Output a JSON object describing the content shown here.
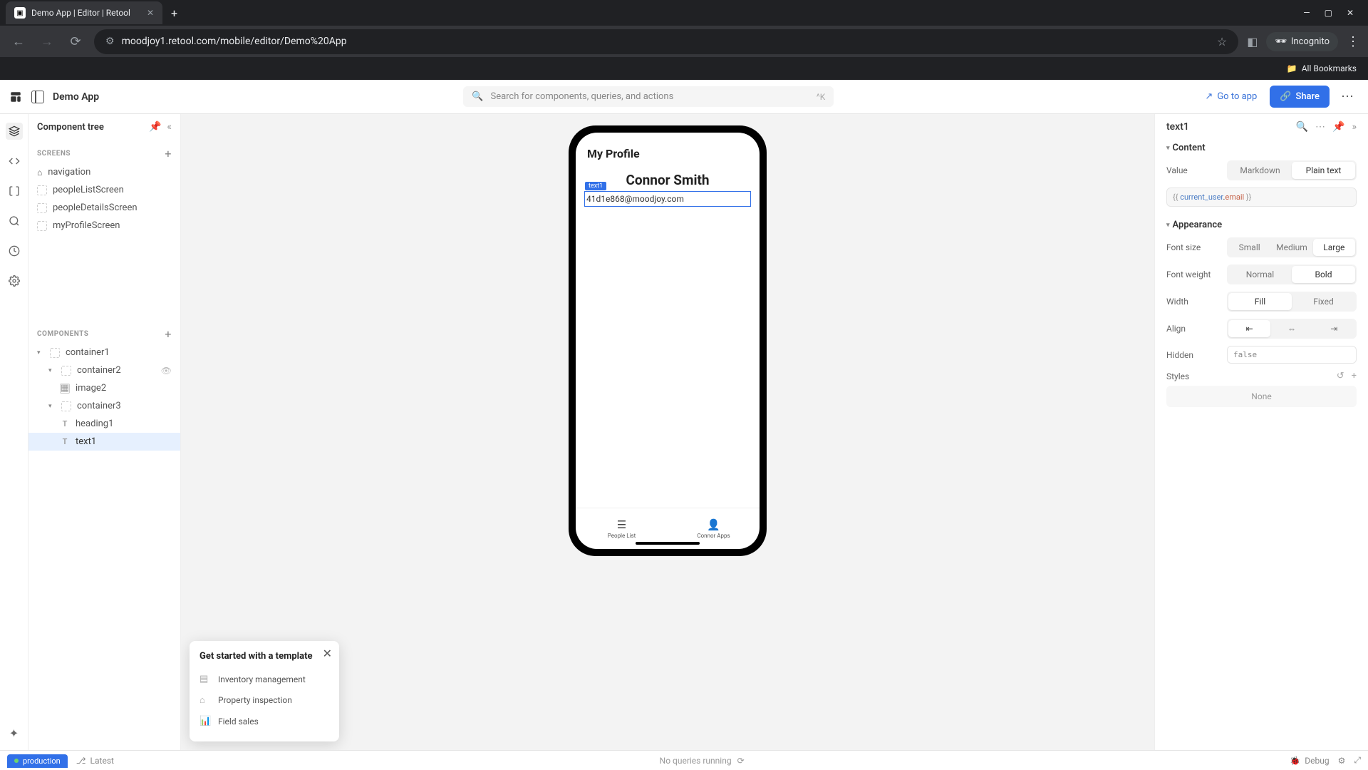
{
  "browser": {
    "tab_title": "Demo App | Editor | Retool",
    "url": "moodjoy1.retool.com/mobile/editor/Demo%20App",
    "incognito_label": "Incognito",
    "all_bookmarks": "All Bookmarks"
  },
  "topbar": {
    "app_name": "Demo App",
    "search_placeholder": "Search for components, queries, and actions",
    "search_shortcut": "^K",
    "go_to_app": "Go to app",
    "share": "Share"
  },
  "left_panel": {
    "title": "Component tree",
    "screens_label": "SCREENS",
    "components_label": "COMPONENTS",
    "screens": {
      "navigation": "navigation",
      "peopleList": "peopleListScreen",
      "peopleDetails": "peopleDetailsScreen",
      "myProfile": "myProfileScreen"
    },
    "components": {
      "container1": "container1",
      "container2": "container2",
      "image2": "image2",
      "container3": "container3",
      "heading1": "heading1",
      "text1": "text1"
    }
  },
  "phone": {
    "header_title": "My Profile",
    "profile_name": "Connor Smith",
    "comp_tag": "text1",
    "profile_email": "41d1e868@moodjoy.com",
    "tab1": "People List",
    "tab2": "Connor Apps"
  },
  "template_popup": {
    "title": "Get started with a template",
    "item1": "Inventory management",
    "item2": "Property inspection",
    "item3": "Field sales"
  },
  "inspector": {
    "component_name": "text1",
    "content_label": "Content",
    "value_label": "Value",
    "markdown": "Markdown",
    "plaintext": "Plain text",
    "value_code_pre": "{{ ",
    "value_code_obj": "current_user",
    "value_code_dot": ".",
    "value_code_prop": "email",
    "value_code_post": " }}",
    "appearance_label": "Appearance",
    "fontsize_label": "Font size",
    "small": "Small",
    "medium": "Medium",
    "large": "Large",
    "fontweight_label": "Font weight",
    "normal": "Normal",
    "bold": "Bold",
    "width_label": "Width",
    "fill": "Fill",
    "fixed": "Fixed",
    "align_label": "Align",
    "hidden_label": "Hidden",
    "hidden_value": "false",
    "styles_label": "Styles",
    "styles_none": "None"
  },
  "bottom_bar": {
    "env": "production",
    "latest": "Latest",
    "center": "No queries running",
    "debug": "Debug"
  }
}
